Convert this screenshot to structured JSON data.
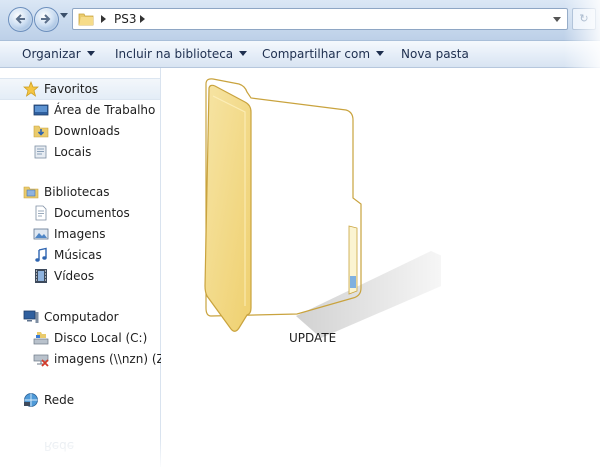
{
  "address": {
    "crumbs": [
      "PS3"
    ]
  },
  "commandbar": {
    "organize": "Organizar",
    "include_library": "Incluir na biblioteca",
    "share": "Compartilhar com",
    "new_folder": "Nova pasta"
  },
  "sidebar": {
    "favorites": {
      "label": "Favoritos",
      "items": [
        "Área de Trabalho",
        "Downloads",
        "Locais"
      ]
    },
    "libraries": {
      "label": "Bibliotecas",
      "items": [
        "Documentos",
        "Imagens",
        "Músicas",
        "Vídeos"
      ]
    },
    "computer": {
      "label": "Computador",
      "items": [
        "Disco Local (C:)",
        "imagens (\\\\nzn) (Z:)"
      ]
    },
    "network": {
      "label": "Rede",
      "reflection": "Rede"
    }
  },
  "content": {
    "items": [
      {
        "name": "UPDATE",
        "type": "folder-icon"
      }
    ]
  },
  "colors": {
    "folder": "#f2d275",
    "accent": "#3c6fb0",
    "titlebar": "#c9daee"
  }
}
